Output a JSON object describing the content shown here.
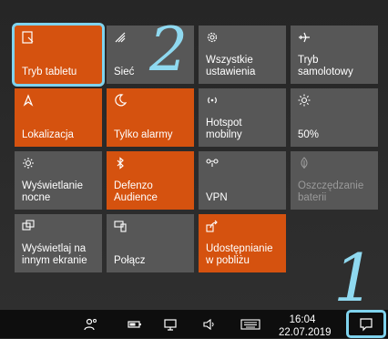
{
  "tiles": [
    {
      "label": "Tryb tabletu",
      "icon": "tablet-mode-icon",
      "state": "on"
    },
    {
      "label": "Sieć",
      "icon": "network-icon",
      "state": "off"
    },
    {
      "label": "Wszystkie\nustawienia",
      "icon": "gear-icon",
      "state": "off"
    },
    {
      "label": "Tryb\nsamolotowy",
      "icon": "airplane-icon",
      "state": "off"
    },
    {
      "label": "Lokalizacja",
      "icon": "location-icon",
      "state": "on"
    },
    {
      "label": "Tylko alarmy",
      "icon": "moon-icon",
      "state": "on"
    },
    {
      "label": "Hotspot\nmobilny",
      "icon": "hotspot-icon",
      "state": "off"
    },
    {
      "label": "50%",
      "icon": "brightness-icon",
      "state": "off"
    },
    {
      "label": "Wyświetlanie\nnocne",
      "icon": "night-light-icon",
      "state": "off"
    },
    {
      "label": "Defenzo\nAudience",
      "icon": "bluetooth-icon",
      "state": "on"
    },
    {
      "label": "VPN",
      "icon": "vpn-icon",
      "state": "off"
    },
    {
      "label": "Oszczędzanie\nbaterii",
      "icon": "battery-saver-icon",
      "state": "disabled"
    },
    {
      "label": "Wyświetlaj na\ninnym ekranie",
      "icon": "project-icon",
      "state": "off"
    },
    {
      "label": "Połącz",
      "icon": "connect-icon",
      "state": "off"
    },
    {
      "label": "Udostępnianie\nw pobliżu",
      "icon": "nearby-share-icon",
      "state": "on"
    }
  ],
  "annotations": {
    "step1": "1",
    "step2": "2"
  },
  "taskbar": {
    "time": "16:04",
    "date": "22.07.2019",
    "icons": [
      "people-icon",
      "battery-icon",
      "network-tray-icon",
      "volume-icon",
      "keyboard-icon",
      "action-center-icon"
    ]
  },
  "colors": {
    "active_tile": "#d5520f",
    "inactive_tile": "#575757",
    "highlight": "#7fd3ee"
  }
}
